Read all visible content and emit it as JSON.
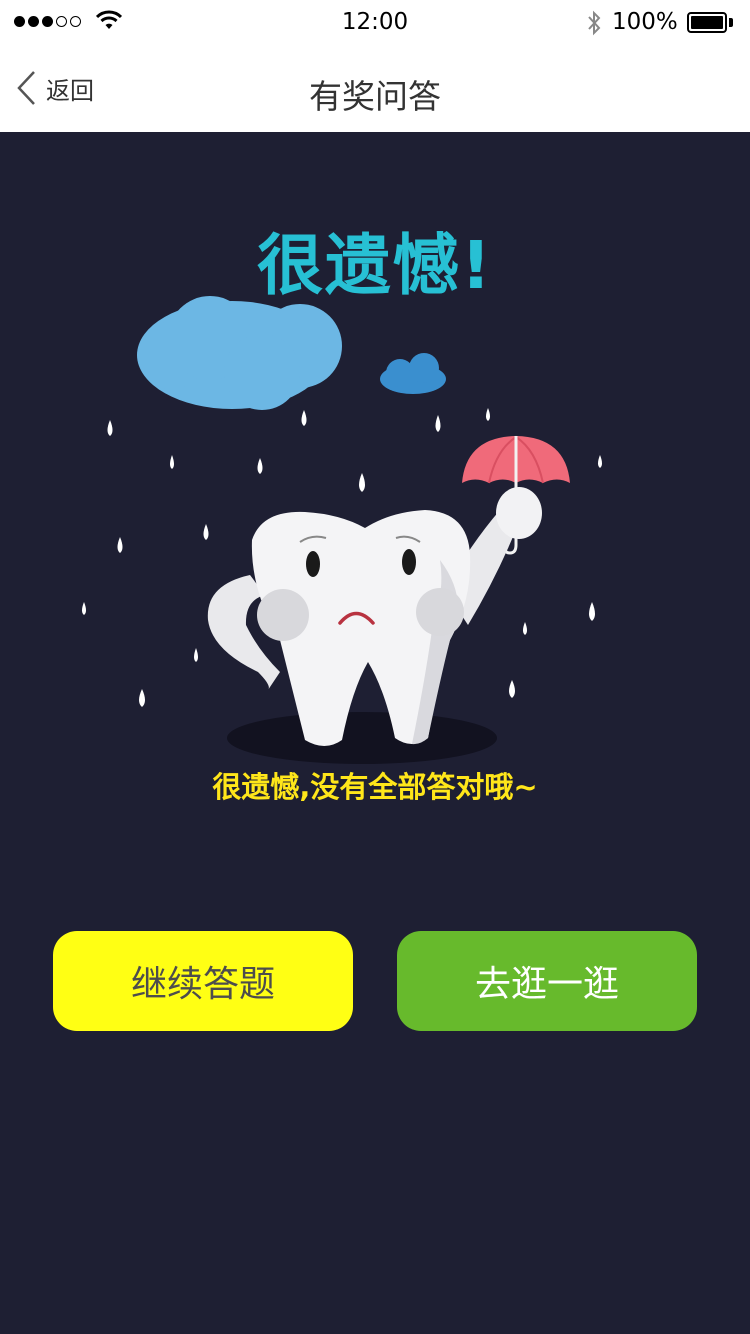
{
  "status_bar": {
    "time": "12:00",
    "battery": "100%",
    "signal_icon": "signal-dots-icon",
    "wifi_icon": "wifi-icon",
    "bluetooth_icon": "bluetooth-icon"
  },
  "nav": {
    "back_label": "返回",
    "title": "有奖问答"
  },
  "result": {
    "headline": "很遗憾!",
    "message": "很遗憾,没有全部答对哦~"
  },
  "buttons": {
    "continue_label": "继续答题",
    "browse_label": "去逛一逛"
  },
  "colors": {
    "background": "#1e1f33",
    "headline": "#27c0d4",
    "message": "#ffe61a",
    "continue_button": "#ffff14",
    "browse_button": "#67ba2c"
  }
}
